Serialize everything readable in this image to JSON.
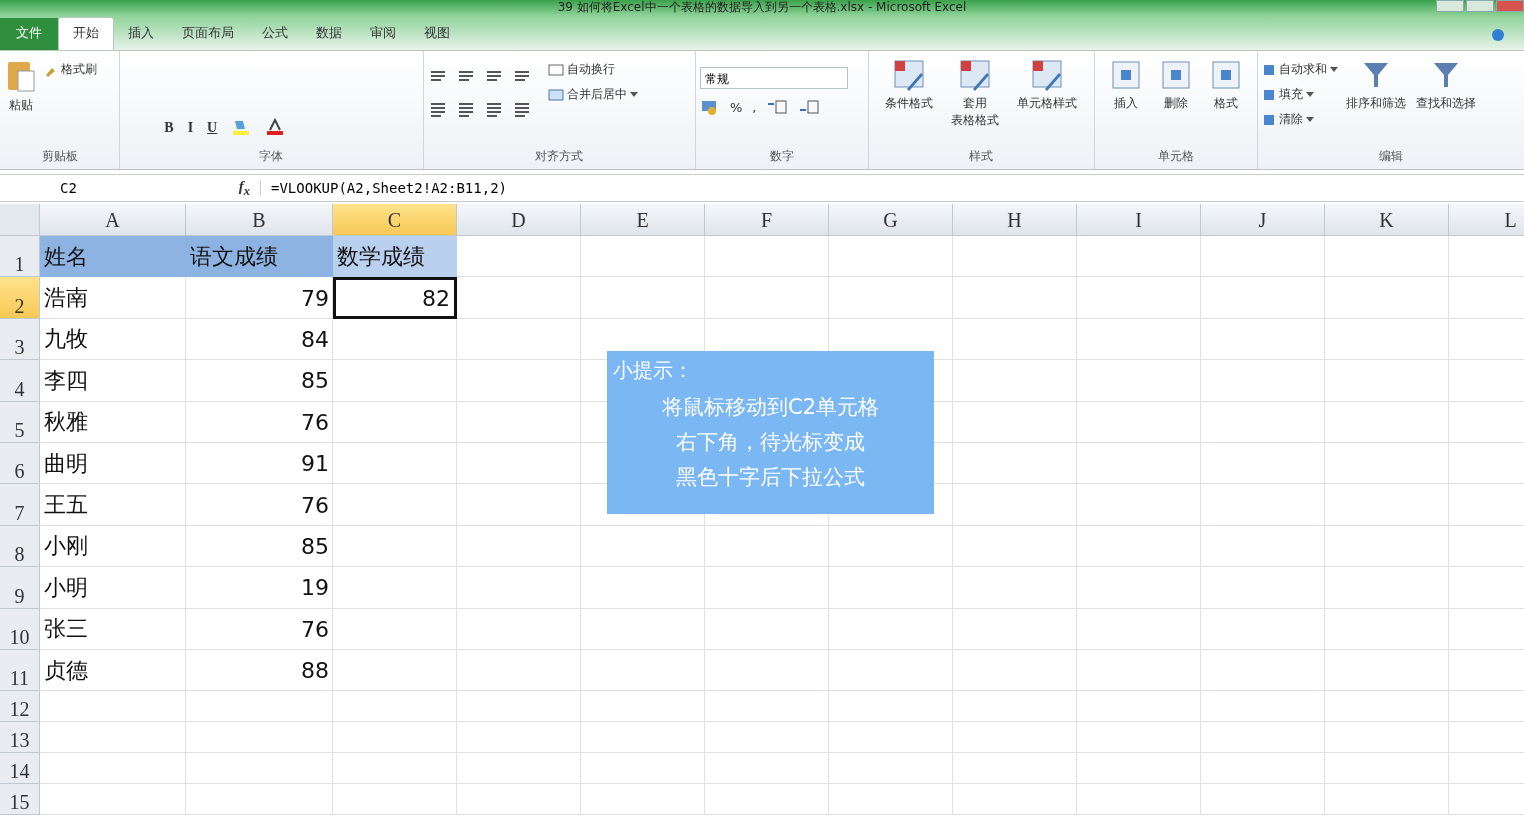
{
  "window": {
    "title": "39 如何将Excel中一个表格的数据导入到另一个表格.xlsx - Microsoft Excel"
  },
  "tabs": [
    {
      "label": "文件",
      "kind": "file",
      "selected": false
    },
    {
      "label": "开始",
      "kind": "tab",
      "selected": true
    },
    {
      "label": "插入",
      "kind": "tab",
      "selected": false
    },
    {
      "label": "页面布局",
      "kind": "tab",
      "selected": false
    },
    {
      "label": "公式",
      "kind": "tab",
      "selected": false
    },
    {
      "label": "数据",
      "kind": "tab",
      "selected": false
    },
    {
      "label": "审阅",
      "kind": "tab",
      "selected": false
    },
    {
      "label": "视图",
      "kind": "tab",
      "selected": false
    }
  ],
  "ribbon": {
    "clipboard": {
      "paste": "粘贴",
      "format_painter": "格式刷",
      "label": "剪贴板"
    },
    "font": {
      "buttons": [
        "B",
        "I",
        "U"
      ],
      "label": "字体"
    },
    "alignment": {
      "wrap": "自动换行",
      "merge": "合并后居中",
      "label": "对齐方式"
    },
    "number": {
      "format": "常规",
      "percent": "%",
      "comma": ",",
      "label": "数字"
    },
    "styles": {
      "buttons": [
        [
          "条件格式"
        ],
        [
          "套用",
          "表格格式"
        ],
        [
          "单元格样式"
        ]
      ],
      "label": "样式"
    },
    "cells": {
      "buttons": [
        "插入",
        "删除",
        "格式"
      ],
      "label": "单元格"
    },
    "editing": {
      "small": [
        "自动求和",
        "填充",
        "清除"
      ],
      "buttons": [
        "排序和筛选",
        "查找和选择"
      ],
      "label": "编辑"
    }
  },
  "formula_bar": {
    "name_box": "C2",
    "fx": "f$_{x}$",
    "formula": "=VLOOKUP(A2,Sheet2!A2:B11,2)"
  },
  "columns": [
    {
      "label": "A",
      "selected": false
    },
    {
      "label": "B",
      "selected": false
    },
    {
      "label": "C",
      "selected": true
    },
    {
      "label": "D",
      "selected": false
    },
    {
      "label": "E",
      "selected": false
    },
    {
      "label": "F",
      "selected": false
    },
    {
      "label": "G",
      "selected": false
    },
    {
      "label": "H",
      "selected": false
    },
    {
      "label": "I",
      "selected": false
    },
    {
      "label": "J",
      "selected": false
    },
    {
      "label": "K",
      "selected": false
    },
    {
      "label": "L",
      "selected": false
    }
  ],
  "rows": [
    {
      "number": "1",
      "kind": "header",
      "selected": false,
      "cells": [
        "姓名",
        "语文成绩",
        "数学成绩"
      ]
    },
    {
      "number": "2",
      "kind": "data",
      "selected": true,
      "cells": [
        "浩南",
        "79",
        "82"
      ]
    },
    {
      "number": "3",
      "kind": "data",
      "selected": false,
      "cells": [
        "九牧",
        "84"
      ]
    },
    {
      "number": "4",
      "kind": "data",
      "selected": false,
      "cells": [
        "李四",
        "85"
      ]
    },
    {
      "number": "5",
      "kind": "data",
      "selected": false,
      "cells": [
        "秋雅",
        "76"
      ]
    },
    {
      "number": "6",
      "kind": "data",
      "selected": false,
      "cells": [
        "曲明",
        "91"
      ]
    },
    {
      "number": "7",
      "kind": "data",
      "selected": false,
      "cells": [
        "王五",
        "76"
      ]
    },
    {
      "number": "8",
      "kind": "data",
      "selected": false,
      "cells": [
        "小刚",
        "85"
      ]
    },
    {
      "number": "9",
      "kind": "data",
      "selected": false,
      "cells": [
        "小明",
        "19"
      ]
    },
    {
      "number": "10",
      "kind": "data",
      "selected": false,
      "cells": [
        "张三",
        "76"
      ]
    },
    {
      "number": "11",
      "kind": "data",
      "selected": false,
      "cells": [
        "贞德",
        "88"
      ]
    },
    {
      "number": "12",
      "kind": "empty",
      "selected": false,
      "cells": []
    },
    {
      "number": "13",
      "kind": "empty",
      "selected": false,
      "cells": []
    },
    {
      "number": "14",
      "kind": "empty",
      "selected": false,
      "cells": []
    },
    {
      "number": "15",
      "kind": "empty",
      "selected": false,
      "cells": []
    }
  ],
  "tip": {
    "title": "小提示：",
    "lines": [
      "将鼠标移动到C2单元格",
      "右下角，待光标变成",
      "黑色十字后下拉公式"
    ]
  }
}
